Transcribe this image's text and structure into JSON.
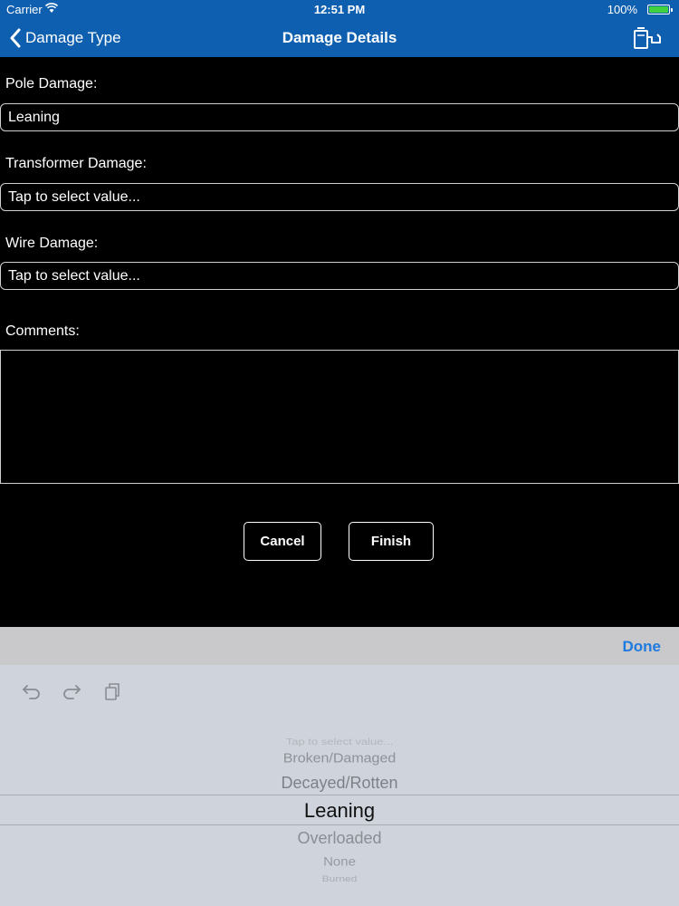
{
  "status_bar": {
    "carrier": "Carrier",
    "time": "12:51 PM",
    "battery": "100%"
  },
  "nav": {
    "back_label": "Damage Type",
    "title": "Damage Details",
    "action_icon": "gas-pump-icon"
  },
  "form": {
    "pole_label": "Pole Damage:",
    "pole_value": "Leaning",
    "transformer_label": "Transformer Damage:",
    "transformer_value": "Tap to select value...",
    "wire_label": "Wire Damage:",
    "wire_value": "Tap to select value...",
    "comments_label": "Comments:",
    "comments_value": ""
  },
  "buttons": {
    "cancel": "Cancel",
    "finish": "Finish"
  },
  "picker": {
    "done_label": "Done",
    "toolbar_icons": [
      "undo-icon",
      "redo-icon",
      "paste-icon"
    ],
    "options": [
      "Tap to select value...",
      "Broken/Damaged",
      "Decayed/Rotten",
      "Leaning",
      "Overloaded",
      "None",
      "Burned"
    ],
    "selected": "Leaning"
  },
  "colors": {
    "nav_bar": "#0f5fb0",
    "background": "#000000",
    "picker_bg": "#cfd3db",
    "done_accent": "#1f7ae0"
  }
}
